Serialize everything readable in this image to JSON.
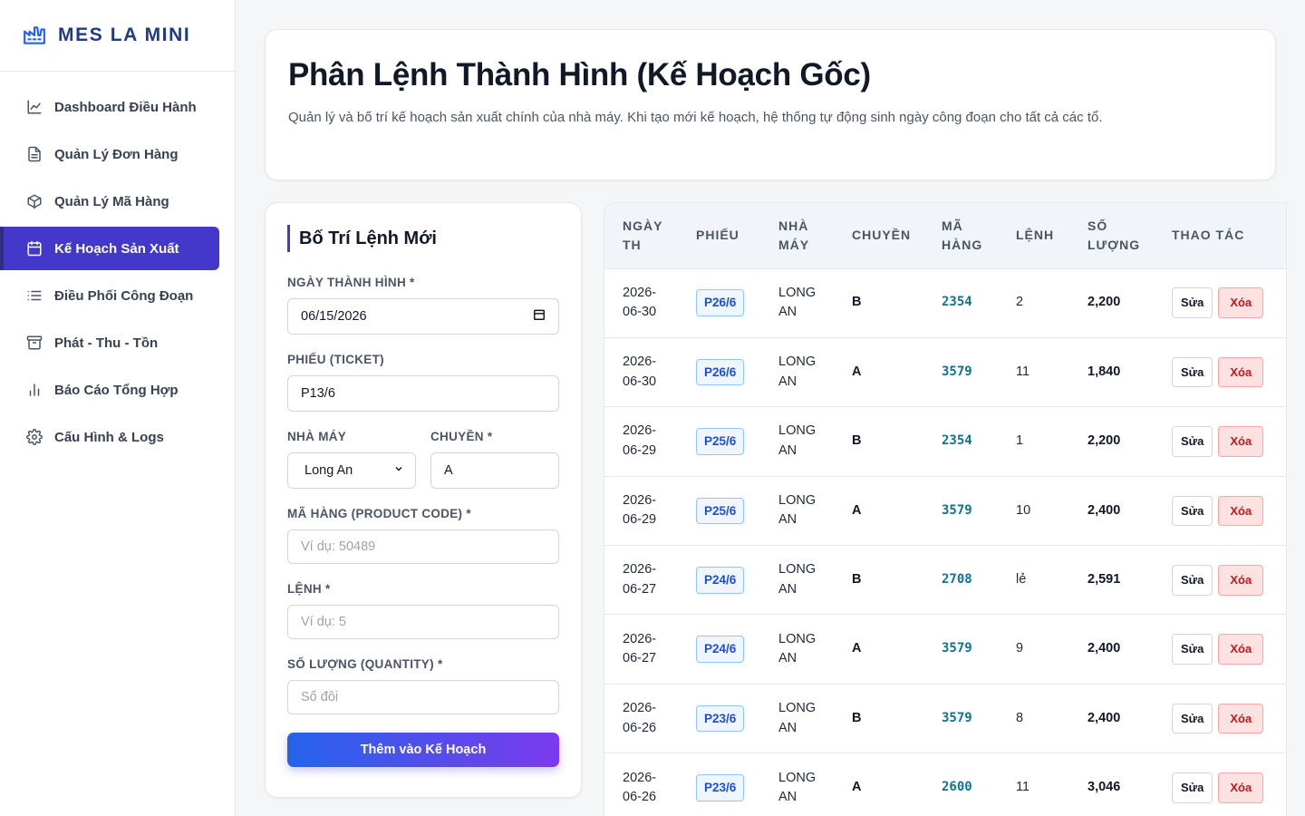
{
  "brand": {
    "name": "MES LA MINI",
    "icon": "factory-icon"
  },
  "sidebar": {
    "items": [
      {
        "label": "Dashboard Điều Hành",
        "icon": "line-chart-icon"
      },
      {
        "label": "Quản Lý Đơn Hàng",
        "icon": "document-icon"
      },
      {
        "label": "Quản Lý Mã Hàng",
        "icon": "box-icon"
      },
      {
        "label": "Kế Hoạch Sản Xuất",
        "icon": "calendar-icon",
        "active": true
      },
      {
        "label": "Điều Phối Công Đoạn",
        "icon": "list-icon"
      },
      {
        "label": "Phát - Thu - Tồn",
        "icon": "archive-icon"
      },
      {
        "label": "Báo Cáo Tổng Hợp",
        "icon": "bar-chart-icon"
      },
      {
        "label": "Cấu Hình & Logs",
        "icon": "gear-icon"
      }
    ]
  },
  "header": {
    "title": "Phân Lệnh Thành Hình (Kế Hoạch Gốc)",
    "description": "Quản lý và bố trí kế hoạch sản xuất chính của nhà máy. Khi tạo mới kế hoạch, hệ thống tự động sinh ngày công đoạn cho tất cả các tổ."
  },
  "form": {
    "title": "Bố Trí Lệnh Mới",
    "date_label": "NGÀY THÀNH HÌNH *",
    "date_value": "06/15/2026",
    "ticket_label": "PHIẾU (TICKET)",
    "ticket_value": "P13/6",
    "factory_label": "NHÀ MÁY",
    "factory_value": "Long An",
    "line_label": "CHUYỀN *",
    "line_value": "A",
    "code_label": "MÃ HÀNG (PRODUCT CODE) *",
    "code_placeholder": "Ví dụ: 50489",
    "order_label": "LỆNH *",
    "order_placeholder": "Ví dụ: 5",
    "qty_label": "SỐ LƯỢNG (QUANTITY) *",
    "qty_placeholder": "Số đôi",
    "submit_label": "Thêm vào Kế Hoạch"
  },
  "table": {
    "headers": {
      "date_1": "NGÀY",
      "date_2": "TH",
      "ticket": "PHIẾU",
      "factory_1": "NHÀ",
      "factory_2": "MÁY",
      "line": "CHUYỀN",
      "code_1": "MÃ",
      "code_2": "HÀNG",
      "order": "LỆNH",
      "qty_1": "SỐ",
      "qty_2": "LƯỢNG",
      "actions": "THAO TÁC"
    },
    "edit_label": "Sửa",
    "delete_label": "Xóa",
    "rows": [
      {
        "date_1": "2026-",
        "date_2": "06-30",
        "ticket": "P26/6",
        "factory_1": "LONG",
        "factory_2": "AN",
        "line": "B",
        "code": "2354",
        "order": "2",
        "qty": "2,200"
      },
      {
        "date_1": "2026-",
        "date_2": "06-30",
        "ticket": "P26/6",
        "factory_1": "LONG",
        "factory_2": "AN",
        "line": "A",
        "code": "3579",
        "order": "11",
        "qty": "1,840"
      },
      {
        "date_1": "2026-",
        "date_2": "06-29",
        "ticket": "P25/6",
        "factory_1": "LONG",
        "factory_2": "AN",
        "line": "B",
        "code": "2354",
        "order": "1",
        "qty": "2,200"
      },
      {
        "date_1": "2026-",
        "date_2": "06-29",
        "ticket": "P25/6",
        "factory_1": "LONG",
        "factory_2": "AN",
        "line": "A",
        "code": "3579",
        "order": "10",
        "qty": "2,400"
      },
      {
        "date_1": "2026-",
        "date_2": "06-27",
        "ticket": "P24/6",
        "factory_1": "LONG",
        "factory_2": "AN",
        "line": "B",
        "code": "2708",
        "order": "lẻ",
        "qty": "2,591"
      },
      {
        "date_1": "2026-",
        "date_2": "06-27",
        "ticket": "P24/6",
        "factory_1": "LONG",
        "factory_2": "AN",
        "line": "A",
        "code": "3579",
        "order": "9",
        "qty": "2,400"
      },
      {
        "date_1": "2026-",
        "date_2": "06-26",
        "ticket": "P23/6",
        "factory_1": "LONG",
        "factory_2": "AN",
        "line": "B",
        "code": "3579",
        "order": "8",
        "qty": "2,400"
      },
      {
        "date_1": "2026-",
        "date_2": "06-26",
        "ticket": "P23/6",
        "factory_1": "LONG",
        "factory_2": "AN",
        "line": "A",
        "code": "2600",
        "order": "11",
        "qty": "3,046"
      }
    ]
  }
}
